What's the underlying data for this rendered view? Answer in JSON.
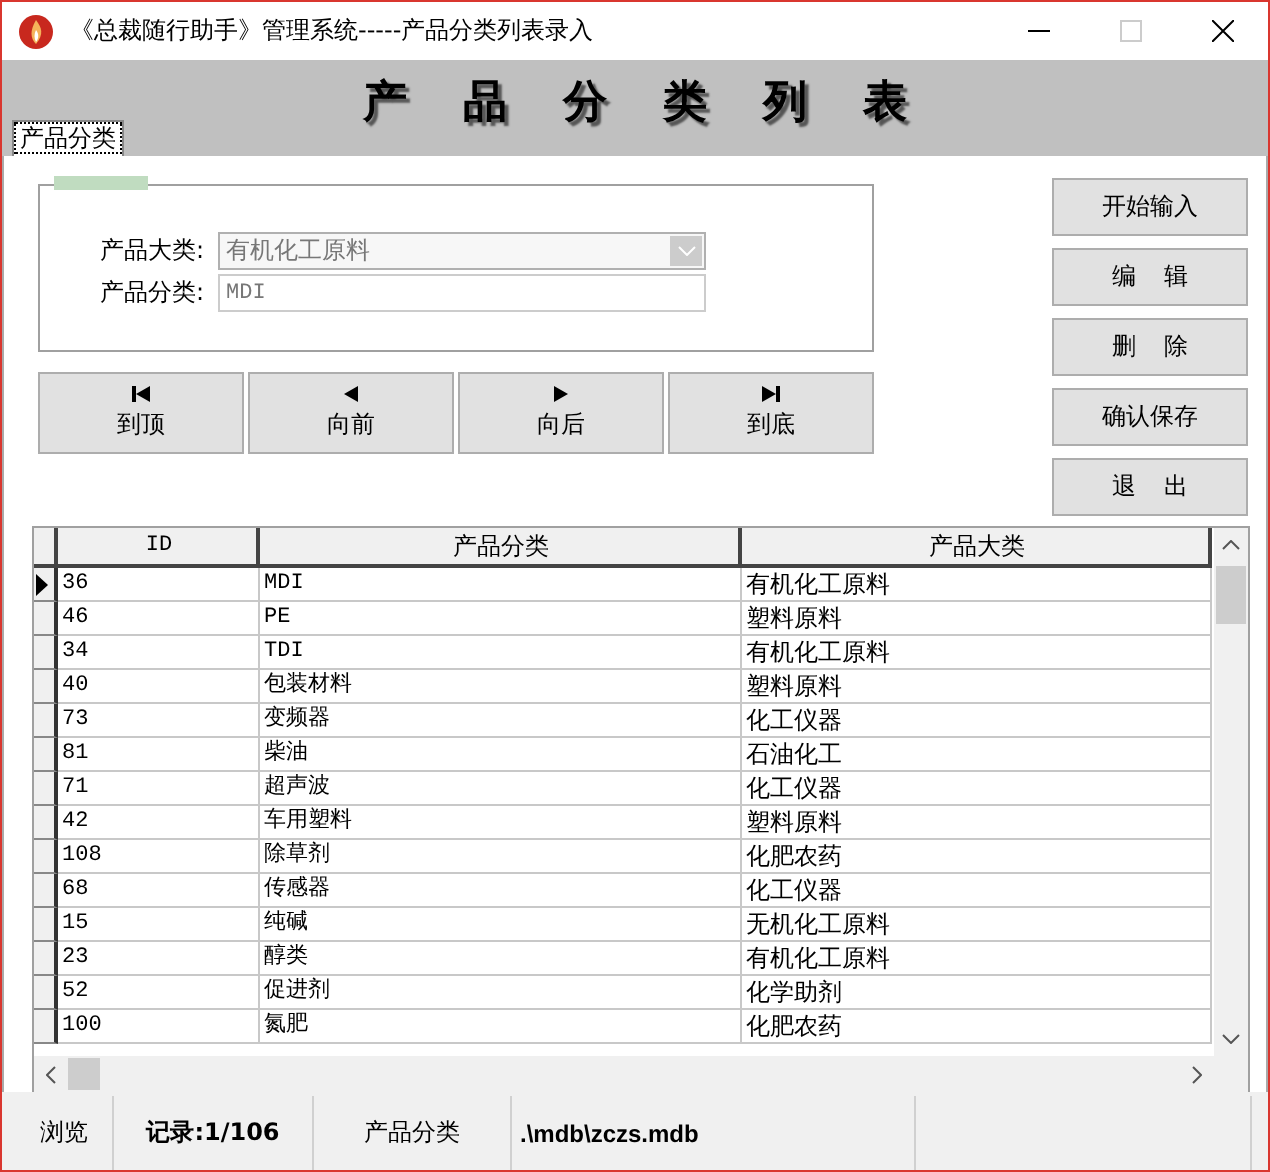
{
  "window": {
    "title": "《总裁随行助手》管理系统-----产品分类列表录入"
  },
  "header": {
    "title": "产品分类列表"
  },
  "tabs": [
    {
      "label": "产品分类",
      "selected": true
    }
  ],
  "form": {
    "fields": [
      {
        "kind": "combo",
        "label": "产品大类:",
        "value": "有机化工原料"
      },
      {
        "kind": "text",
        "label": "产品分类:",
        "value": "MDI"
      }
    ]
  },
  "nav_buttons": [
    {
      "kind": "first",
      "label": "到顶"
    },
    {
      "kind": "prev",
      "label": "向前"
    },
    {
      "kind": "next",
      "label": "向后"
    },
    {
      "kind": "last",
      "label": "到底"
    }
  ],
  "action_buttons": [
    "开始输入",
    "编 辑",
    "删 除",
    "确认保存",
    "退 出"
  ],
  "table": {
    "columns": [
      "ID",
      "产品分类",
      "产品大类"
    ],
    "rows": [
      {
        "selected": true,
        "cells": [
          "36",
          "MDI",
          "有机化工原料"
        ]
      },
      {
        "selected": false,
        "cells": [
          "46",
          "PE",
          "塑料原料"
        ]
      },
      {
        "selected": false,
        "cells": [
          "34",
          "TDI",
          "有机化工原料"
        ]
      },
      {
        "selected": false,
        "cells": [
          "40",
          "包装材料",
          "塑料原料"
        ]
      },
      {
        "selected": false,
        "cells": [
          "73",
          "变频器",
          "化工仪器"
        ]
      },
      {
        "selected": false,
        "cells": [
          "81",
          "柴油",
          "石油化工"
        ]
      },
      {
        "selected": false,
        "cells": [
          "71",
          "超声波",
          "化工仪器"
        ]
      },
      {
        "selected": false,
        "cells": [
          "42",
          "车用塑料",
          "塑料原料"
        ]
      },
      {
        "selected": false,
        "cells": [
          "108",
          "除草剂",
          "化肥农药"
        ]
      },
      {
        "selected": false,
        "cells": [
          "68",
          "传感器",
          "化工仪器"
        ]
      },
      {
        "selected": false,
        "cells": [
          "15",
          "纯碱",
          "无机化工原料"
        ]
      },
      {
        "selected": false,
        "cells": [
          "23",
          "醇类",
          "有机化工原料"
        ]
      },
      {
        "selected": false,
        "cells": [
          "52",
          "促进剂",
          "化学助剂"
        ]
      },
      {
        "selected": false,
        "cells": [
          "100",
          "氮肥",
          "化肥农药"
        ]
      }
    ]
  },
  "status_bar": [
    "浏览",
    "记录:1/106",
    "产品分类",
    ".\\mdb\\zczs.mdb"
  ]
}
